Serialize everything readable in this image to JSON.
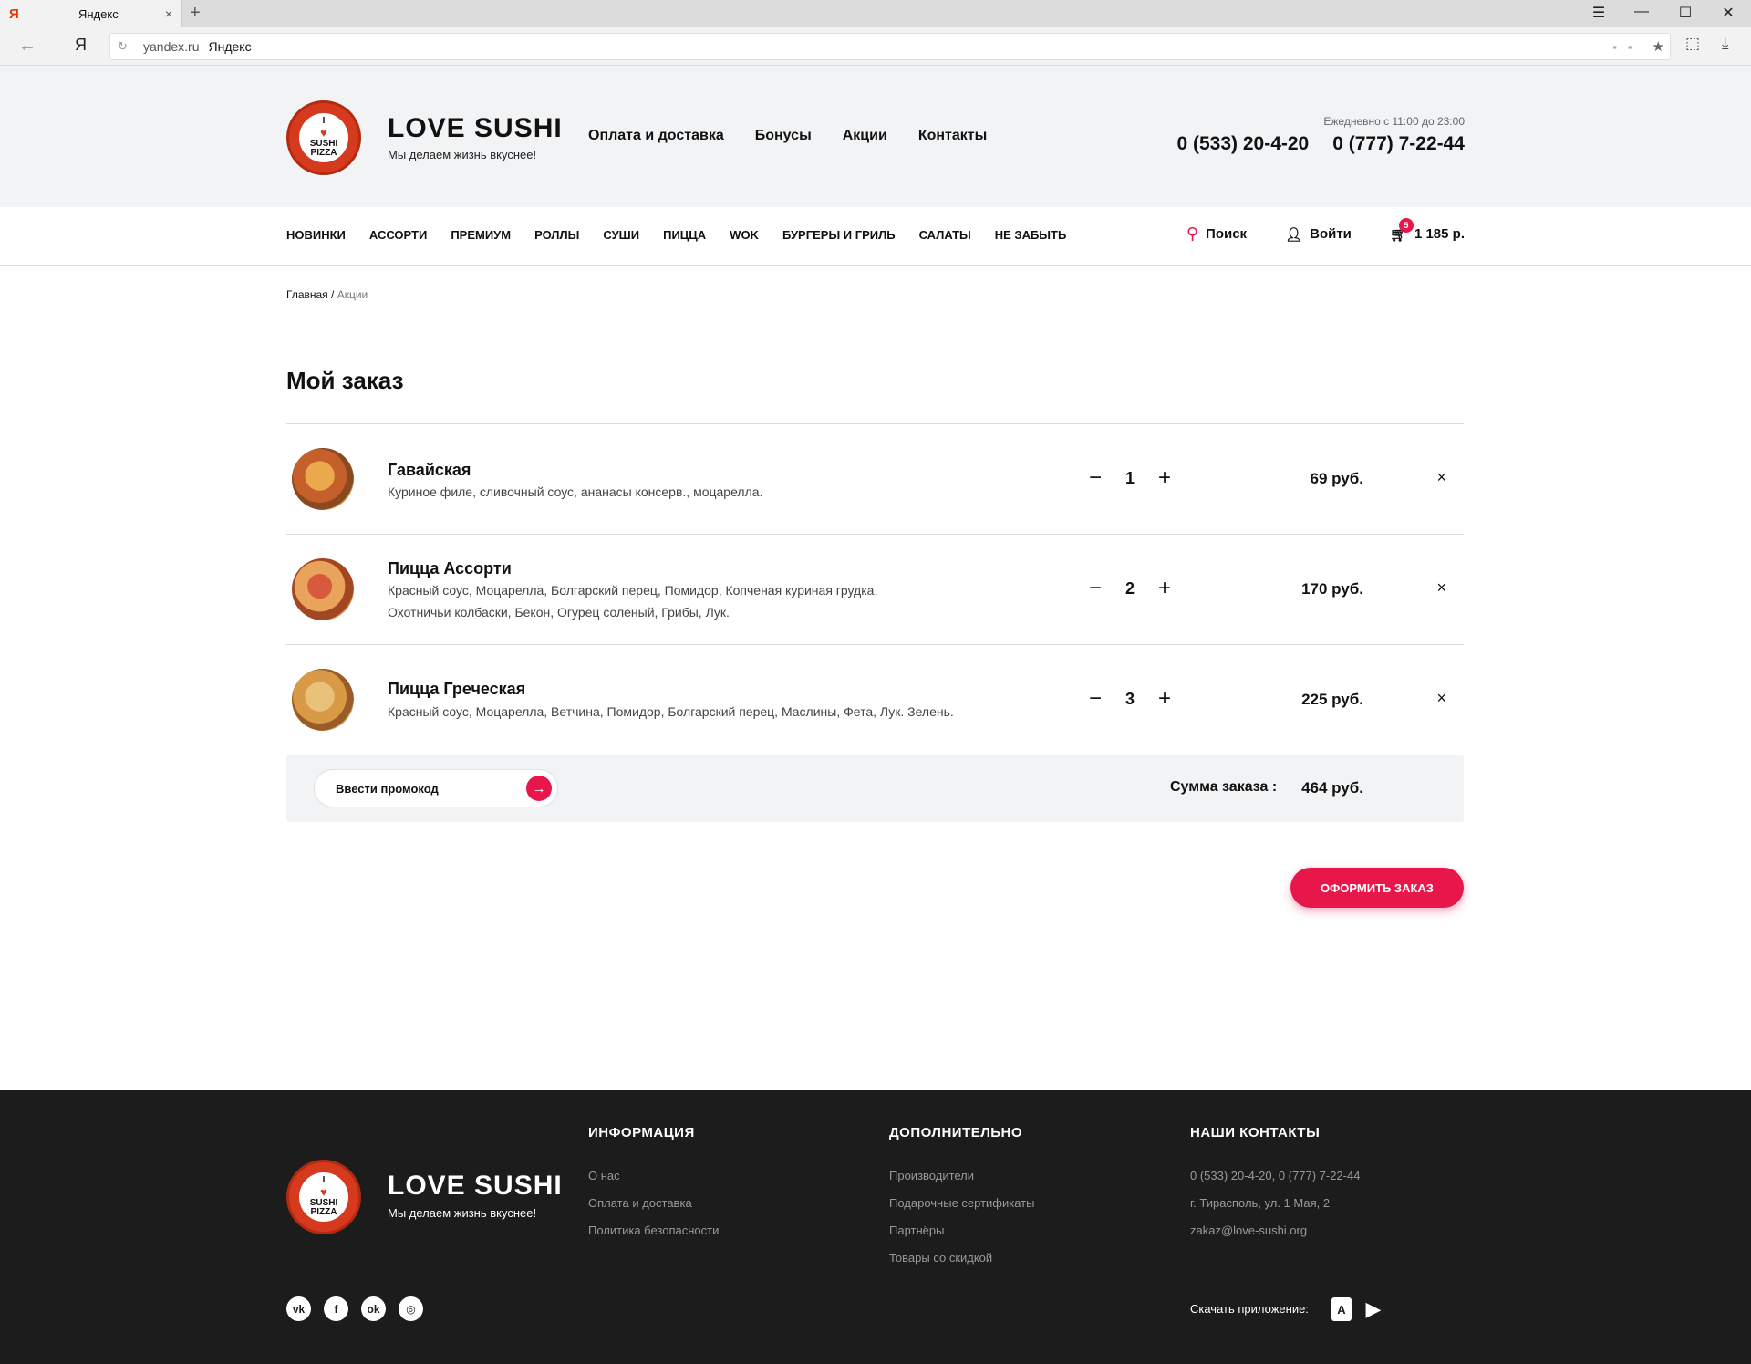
{
  "browser": {
    "tab_logo": "Я",
    "tab_title": "Яндекс",
    "tab_close": "×",
    "new_tab": "+",
    "back": "←",
    "yandex_button": "Я",
    "url_host": "yandex.ru",
    "url_title": "Яндекс",
    "win_menu": "☰",
    "win_min": "—",
    "win_max": "☐",
    "win_close": "✕"
  },
  "header": {
    "brand": "LOVE SUSHI",
    "slogan": "Мы делаем жизнь вкуснее!",
    "logo_top": "I",
    "logo_line1": "SUSHI",
    "logo_amp": "&",
    "logo_line2": "PIZZA",
    "nav": [
      "Оплата и доставка",
      "Бонусы",
      "Акции",
      "Контакты"
    ],
    "hours": "Ежедневно с 11:00 до 23:00",
    "phone1": "0 (533) 20-4-20",
    "phone2": "0 (777) 7-22-44"
  },
  "categories": [
    "НОВИНКИ",
    "АССОРТИ",
    "ПРЕМИУМ",
    "РОЛЛЫ",
    "СУШИ",
    "ПИЦЦА",
    "WOK",
    "БУРГЕРЫ И ГРИЛЬ",
    "САЛАТЫ",
    "НЕ ЗАБЫТЬ"
  ],
  "userbar": {
    "search": "Поиск",
    "login": "Войти",
    "cart_count": "5",
    "cart_total": "1 185 р."
  },
  "breadcrumb": {
    "home": "Главная",
    "sep": "/",
    "current": "Акции"
  },
  "page_title": "Мой заказ",
  "items": [
    {
      "name": "Гавайская",
      "desc": "Куриное филе, сливочный соус, ананасы консерв., моцарелла.",
      "qty": "1",
      "price": "69 руб."
    },
    {
      "name": "Пицца Ассорти",
      "desc": "Красный соус, Моцарелла, Болгарский перец, Помидор, Копченая куриная грудка, Охотничьи колбаски, Бекон, Огурец соленый, Грибы, Лук.",
      "qty": "2",
      "price": "170 руб."
    },
    {
      "name": "Пицца Греческая",
      "desc": "Красный соус, Моцарелла, Ветчина, Помидор, Болгарский перец, Маслины, Фета, Лук. Зелень.",
      "qty": "3",
      "price": "225 руб."
    }
  ],
  "qty_minus": "−",
  "qty_plus": "+",
  "remove": "×",
  "summary": {
    "promo_placeholder": "Ввести промокод",
    "label": "Сумма заказа :",
    "total": "464 руб."
  },
  "order_button": "ОФОРМИТЬ ЗАКАЗ",
  "footer": {
    "brand": "LOVE SUSHI",
    "slogan": "Мы делаем жизнь вкуснее!",
    "info_title": "ИНФОРМАЦИЯ",
    "info_links": [
      "О нас",
      "Оплата и доставка",
      "Политика безопасности"
    ],
    "extra_title": "ДОПОЛНИТЕЛЬНО",
    "extra_links": [
      "Производители",
      "Подарочные сертификаты",
      "Партнёры",
      "Товары со скидкой"
    ],
    "contacts_title": "НАШИ КОНТАКТЫ",
    "contacts": [
      "0 (533) 20-4-20, 0 (777) 7-22-44",
      "г. Тирасполь, ул. 1 Мая, 2",
      "zakaz@love-sushi.org"
    ],
    "download_label": "Скачать приложение:"
  },
  "colors": {
    "accent": "#e8174b",
    "header_bg": "#f2f3f4",
    "footer_bg": "#1c1c1c"
  }
}
